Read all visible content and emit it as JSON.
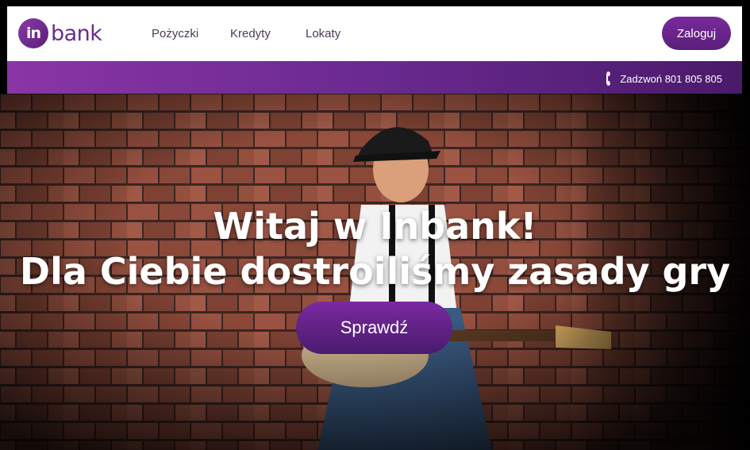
{
  "brand": {
    "logo_badge": "in",
    "logo_text": "bank",
    "accent_color": "#6a2b8f"
  },
  "nav": {
    "items": [
      {
        "label": "Pożyczki"
      },
      {
        "label": "Kredyty"
      },
      {
        "label": "Lokaty"
      }
    ],
    "login_label": "Zaloguj"
  },
  "phone_bar": {
    "icon": "phone-icon",
    "text": "Zadzwoń 801 805 805"
  },
  "hero": {
    "title_line1": "Witaj w Inbank!",
    "title_line2": "Dla Ciebie dostroiliśmy zasady gry",
    "cta_label": "Sprawdź"
  }
}
